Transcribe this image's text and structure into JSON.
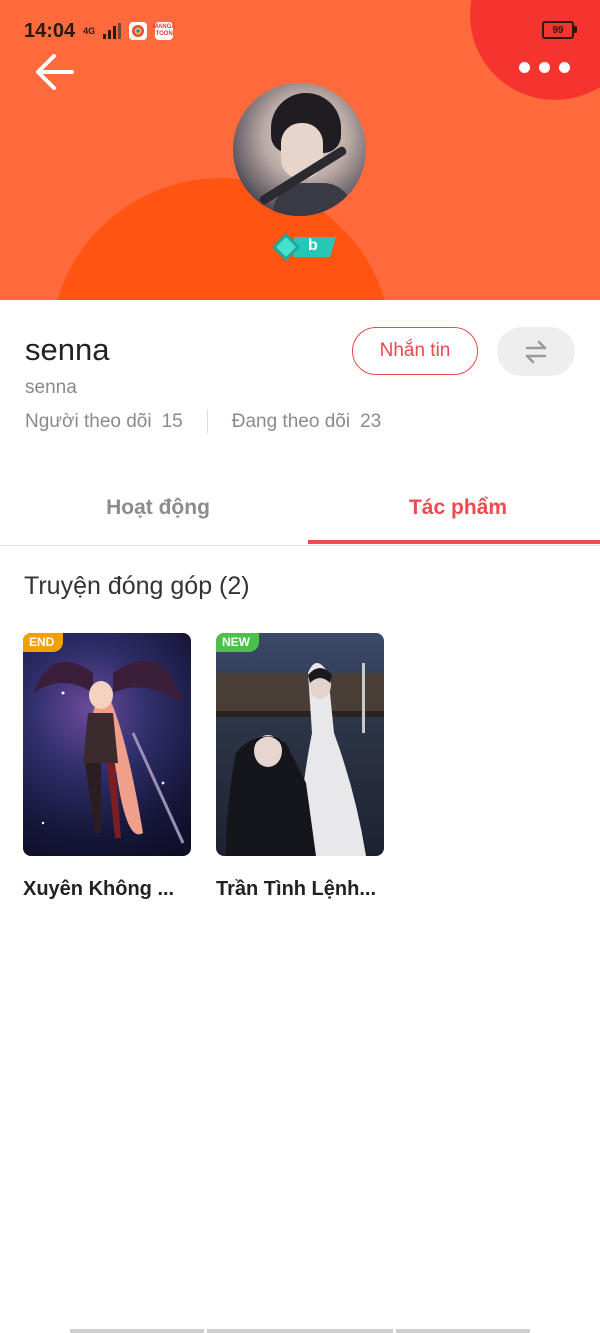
{
  "status_bar": {
    "time": "14:04",
    "network": "4G",
    "battery": "99",
    "app_icon_label": "MANGA TOON"
  },
  "header": {
    "back_icon": "arrow-left-icon",
    "more_icon": "more-dots-icon",
    "badge_letter": "b",
    "colors": {
      "background": "#ff6a3d",
      "accent_circle": "#f5342f",
      "shape": "#ff5412"
    }
  },
  "profile": {
    "name": "senna",
    "username": "senna",
    "followers_label": "Người theo dõi",
    "followers_count": "15",
    "following_label": "Đang theo dõi",
    "following_count": "23",
    "message_button": "Nhắn tin",
    "swap_icon": "swap-arrows-icon"
  },
  "tabs": [
    {
      "label": "Hoạt động",
      "active": false
    },
    {
      "label": "Tác phẩm",
      "active": true
    }
  ],
  "section": {
    "title": "Truyện đóng góp (2)",
    "items": [
      {
        "tag": "END",
        "tag_color": "#f2a000",
        "title": "Xuyên Không ..."
      },
      {
        "tag": "NEW",
        "tag_color": "#4cc14a",
        "title": "Trần Tình Lệnh..."
      }
    ]
  },
  "accent_color": "#ef4b4f"
}
